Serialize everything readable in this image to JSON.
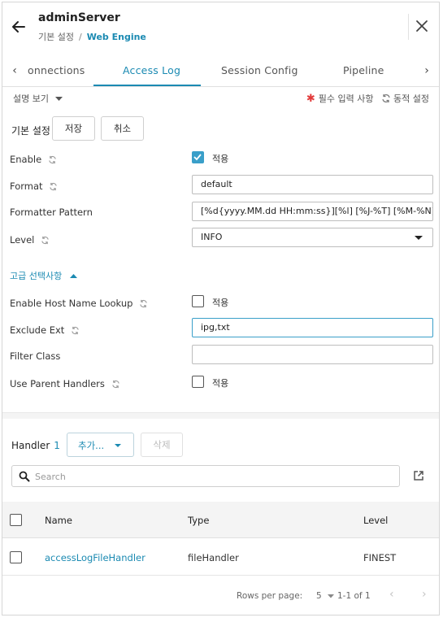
{
  "header": {
    "title": "adminServer",
    "breadcrumb": {
      "parent": "기본 설정",
      "separator": "/",
      "current": "Web Engine"
    }
  },
  "tabs": [
    {
      "label": "onnections",
      "active": false
    },
    {
      "label": "Access Log",
      "active": true
    },
    {
      "label": "Session Config",
      "active": false
    },
    {
      "label": "Pipeline",
      "active": false
    }
  ],
  "description": {
    "toggle_label": "설명 보기",
    "required_legend": "필수 입력 사항",
    "dynamic_legend": "동적 설정"
  },
  "basic": {
    "label": "기본 설정",
    "save_label": "저장",
    "cancel_label": "취소"
  },
  "fields": {
    "enable": {
      "label": "Enable",
      "checked": true,
      "check_label": "적용"
    },
    "format": {
      "label": "Format",
      "value": "default"
    },
    "formatter_pattern": {
      "label": "Formatter Pattern",
      "value": "[%d{yyyy.MM.dd HH:mm:ss}][%l] [%J-%T] [%M-%N] %m%n"
    },
    "level": {
      "label": "Level",
      "value": "INFO"
    }
  },
  "advanced": {
    "toggle_label": "고급 선택사항",
    "enable_host_name_lookup": {
      "label": "Enable Host Name Lookup",
      "checked": false,
      "check_label": "적용"
    },
    "exclude_ext": {
      "label": "Exclude Ext",
      "value": "ipg,txt"
    },
    "filter_class": {
      "label": "Filter Class",
      "value": ""
    },
    "use_parent_handlers": {
      "label": "Use Parent Handlers",
      "checked": false,
      "check_label": "적용"
    }
  },
  "handler": {
    "label": "Handler",
    "count": "1",
    "add_label": "추가...",
    "delete_label": "삭제",
    "search_placeholder": "Search",
    "columns": {
      "name": "Name",
      "type": "Type",
      "level": "Level"
    },
    "rows": [
      {
        "name": "accessLogFileHandler",
        "type": "fileHandler",
        "level": "FINEST"
      }
    ],
    "pagination": {
      "rows_per_page_label": "Rows per page:",
      "rows_per_page": "5",
      "range": "1-1 of 1"
    }
  },
  "colors": {
    "accent": "#1b8ab2",
    "checkbox_on": "#3a9fc9",
    "required": "#e23b3b"
  }
}
